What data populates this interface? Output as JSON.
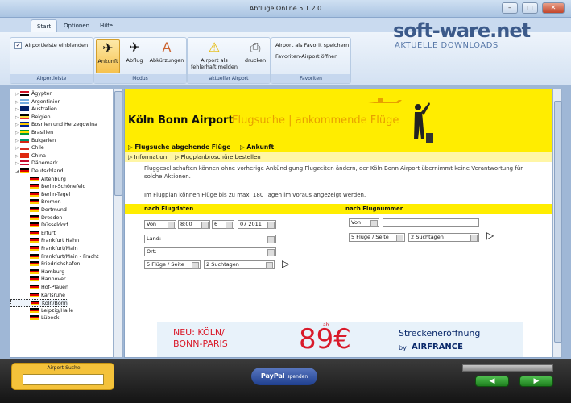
{
  "window": {
    "title": "Abfluge Online 5.1.2.0"
  },
  "ribbon": {
    "tabs": [
      "Start",
      "Optionen",
      "Hilfe"
    ],
    "groups": {
      "airportleiste": {
        "caption": "Airportleiste",
        "checkbox_label": "Airportleiste einblenden",
        "checked": true
      },
      "modus": {
        "caption": "Modus",
        "buttons": [
          "Ankunft",
          "Abflug",
          "Abkürzungen"
        ],
        "active": "Ankunft"
      },
      "aktueller_airport": {
        "caption": "aktueller Airport",
        "buttons": [
          "Airport als fehlerhaft melden",
          "drucken"
        ]
      },
      "favoriten": {
        "caption": "Favoriten",
        "items": [
          "Airport als Favorit speichern",
          "Favoriten-Airport öffnen"
        ]
      }
    }
  },
  "watermark": {
    "brand": "soft-ware.net",
    "tagline": "AKTUELLE DOWNLOADS"
  },
  "tree": {
    "countries": [
      {
        "name": "Ägypten",
        "flag": [
          "#ce1126",
          "#ffffff",
          "#000000"
        ]
      },
      {
        "name": "Argentinien",
        "flag": [
          "#74acdf",
          "#ffffff",
          "#74acdf"
        ]
      },
      {
        "name": "Australien",
        "flag": [
          "#012169",
          "#012169",
          "#012169"
        ]
      },
      {
        "name": "Belgien",
        "flag": [
          "#000000",
          "#fae042",
          "#ed2939"
        ]
      },
      {
        "name": "Bosnien und Herzegowina",
        "flag": [
          "#002395",
          "#fecb00",
          "#002395"
        ]
      },
      {
        "name": "Brasilien",
        "flag": [
          "#009c3b",
          "#ffdf00",
          "#009c3b"
        ]
      },
      {
        "name": "Bulgarien",
        "flag": [
          "#ffffff",
          "#00966e",
          "#d62612"
        ]
      },
      {
        "name": "Chile",
        "flag": [
          "#ffffff",
          "#ffffff",
          "#d52b1e"
        ]
      },
      {
        "name": "China",
        "flag": [
          "#de2910",
          "#de2910",
          "#de2910"
        ]
      },
      {
        "name": "Dänemark",
        "flag": [
          "#c60c30",
          "#ffffff",
          "#c60c30"
        ]
      },
      {
        "name": "Deutschland",
        "flag": [
          "#000000",
          "#dd0000",
          "#ffce00"
        ],
        "expanded": true
      }
    ],
    "cities": [
      "Altenburg",
      "Berlin-Schönefeld",
      "Berlin-Tegel",
      "Bremen",
      "Dortmund",
      "Dresden",
      "Düsseldorf",
      "Erfurt",
      "Frankfurt Hahn",
      "Frankfurt/Main",
      "Frankfurt/Main - Fracht",
      "Friedrichshafen",
      "Hamburg",
      "Hannover",
      "Hof-Plauen",
      "Karlsruhe",
      "Köln/Bonn",
      "Leipzig/Halle",
      "Lübeck"
    ],
    "selected": "Köln/Bonn"
  },
  "content": {
    "airport": "Köln Bonn Airport",
    "section": "Flugsuche | ankommende Flüge",
    "nav_abgehende": "Flugsuche abgehende Flüge",
    "nav_ankunft": "Ankunft",
    "nav_information": "Information",
    "nav_brochure": "Flugplanbroschüre bestellen",
    "notice": "Fluggesellschaften können ohne vorherige Ankündigung Flugzeiten ändern, der Köln Bonn Airport übernimmt keine Verantwortung für solche Aktionen.",
    "range_info": "Im Flugplan können Flüge bis zu max. 180 Tagen im voraus angezeigt werden.",
    "by_date": {
      "title": "nach Flugdaten",
      "von": "Von",
      "time": "8:00",
      "day": "6",
      "month": "07 2011",
      "land": "Land:",
      "ort": "Ort:",
      "per_page": "5 Flüge / Seite",
      "days": "2 Suchtagen"
    },
    "by_number": {
      "title": "nach Flugnummer",
      "von": "Von",
      "per_page": "5 Flüge / Seite",
      "days": "2 Suchtagen"
    },
    "banner": {
      "route": "NEU: KÖLN/ BONN-PARIS",
      "ab": "ab",
      "price": "89€",
      "headline": "Streckeneröffnung",
      "by": "by",
      "airline": "AIRFRANCE"
    }
  },
  "bottom": {
    "search_label": "Airport-Suche",
    "paypal": "PayPal",
    "paypal_sub": "spenden"
  },
  "colors": {
    "yellow": "#ffed00",
    "section": "#e8a000",
    "banner_red": "#d91a2a",
    "airfrance_blue": "#0b2a6b",
    "ribbon": "#d3e1f2"
  }
}
